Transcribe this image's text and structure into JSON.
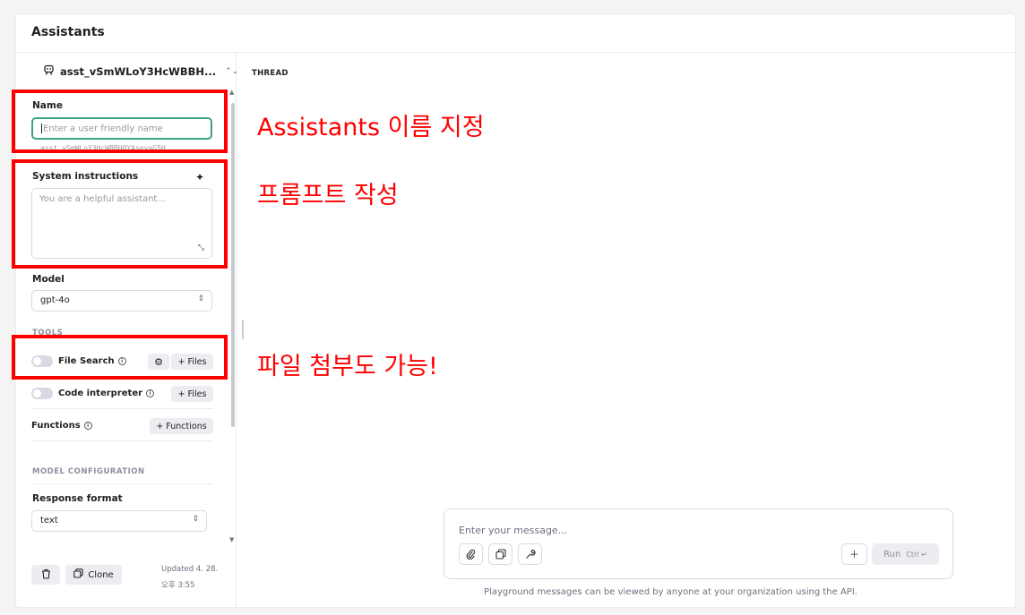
{
  "header": {
    "title": "Assistants"
  },
  "assistant": {
    "selected": "asst_vSmWLoY3HcWBBH...",
    "id_text": "asst_vSmWLoY3HcWBBH0YAseyaG5H"
  },
  "form": {
    "name_label": "Name",
    "name_placeholder": "Enter a user friendly name",
    "instructions_label": "System instructions",
    "instructions_placeholder": "You are a helpful assistant...",
    "model_label": "Model",
    "model_value": "gpt-4o"
  },
  "tools": {
    "section_title": "TOOLS",
    "file_search": {
      "label": "File Search",
      "files_button": "+ Files"
    },
    "code_interpreter": {
      "label": "Code interpreter",
      "files_button": "+ Files"
    },
    "functions": {
      "label": "Functions",
      "button": "+ Functions"
    }
  },
  "model_config": {
    "section_title": "MODEL CONFIGURATION",
    "response_format_label": "Response format",
    "response_format_value": "text"
  },
  "footer": {
    "clone_label": "Clone",
    "updated_line1": "Updated 4. 28.",
    "updated_line2": "오후 3:55"
  },
  "thread": {
    "label": "THREAD",
    "message_placeholder": "Enter your message...",
    "run_label": "Run",
    "run_shortcut": "Ctrl ↵",
    "disclaimer": "Playground messages can be viewed by anyone at your organization using the API."
  },
  "annotations": {
    "name_note": "Assistants 이름 지정",
    "prompt_note": "프롬프트 작성",
    "file_note": "파일 첨부도 가능!",
    "color": "#ff0000"
  },
  "icons": [
    "robot-icon",
    "chevron-updown-icon",
    "sparkle-icon",
    "resize-icon",
    "info-icon",
    "gear-icon",
    "trash-icon",
    "copy-icon",
    "paperclip-icon",
    "image-icon",
    "wrench-icon",
    "plus-icon"
  ]
}
